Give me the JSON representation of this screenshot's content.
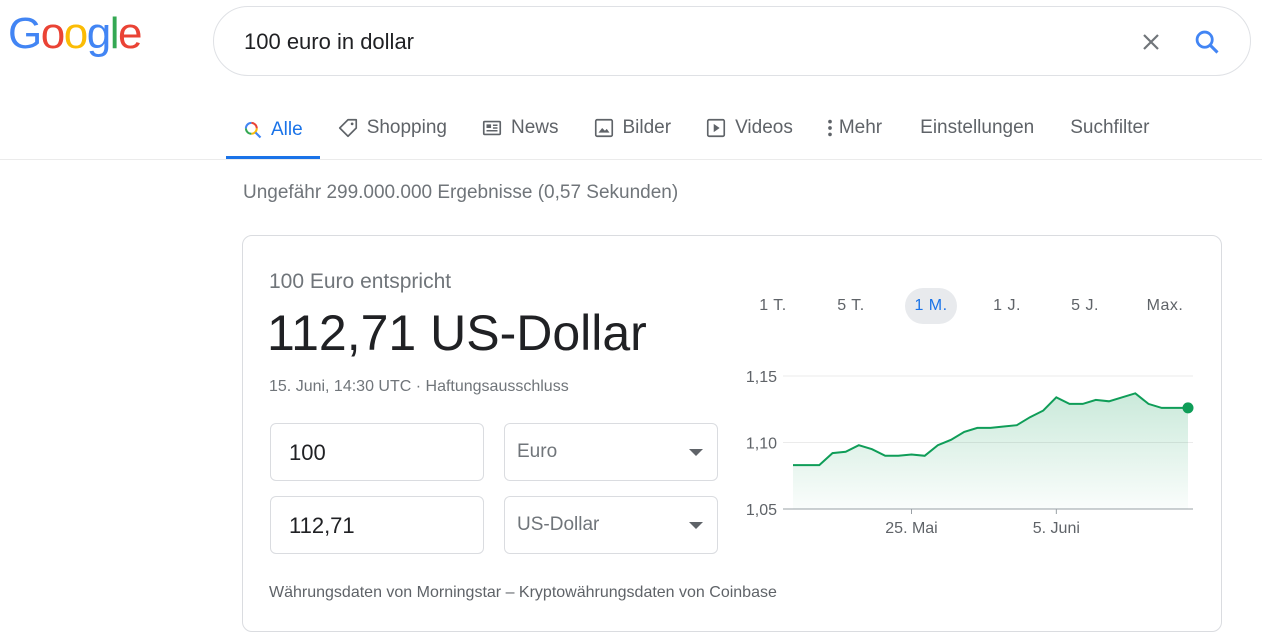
{
  "logo": {
    "letters": [
      "G",
      "o",
      "o",
      "g",
      "l",
      "e"
    ],
    "colors": [
      "#4285f4",
      "#ea4335",
      "#fbbc05",
      "#4285f4",
      "#34a853",
      "#ea4335"
    ]
  },
  "search": {
    "value": "100 euro in dollar",
    "clear_icon": "close-icon",
    "search_icon": "search-icon"
  },
  "tabs": [
    {
      "label": "Alle",
      "icon": "search-icon",
      "active": true
    },
    {
      "label": "Shopping",
      "icon": "tag-icon"
    },
    {
      "label": "News",
      "icon": "news-icon"
    },
    {
      "label": "Bilder",
      "icon": "image-icon"
    },
    {
      "label": "Videos",
      "icon": "video-icon"
    },
    {
      "label": "Mehr",
      "icon": "more-vert-icon"
    },
    {
      "label": "Einstellungen"
    },
    {
      "label": "Suchfilter"
    }
  ],
  "stats": "Ungefähr 299.000.000 Ergebnisse (0,57 Sekunden)",
  "converter": {
    "equals_label": "100 Euro entspricht",
    "result": "112,71 US-Dollar",
    "timestamp": "15. Juni, 14:30 UTC",
    "separator": " · ",
    "disclaimer": "Haftungsausschluss",
    "from_amount": "100",
    "from_currency": "Euro",
    "to_amount": "112,71",
    "to_currency": "US-Dollar",
    "ranges": [
      "1 T.",
      "5 T.",
      "1 M.",
      "1 J.",
      "5 J.",
      "Max."
    ],
    "active_range": "1 M.",
    "footer": {
      "source1": "Währungsdaten von Morningstar",
      "dash": " – ",
      "source2": "Kryptowährungsdaten von Coinbase"
    }
  },
  "colors": {
    "accent": "#1a73e8",
    "line": "#0f9d58"
  },
  "chart_data": {
    "type": "area",
    "x": [
      "",
      "",
      "",
      "",
      "",
      "",
      "",
      "",
      "",
      "",
      "",
      "",
      "",
      "",
      "",
      "",
      "",
      "",
      "",
      "",
      "",
      "",
      "",
      "",
      "",
      "",
      "",
      "",
      "",
      "",
      "",
      ""
    ],
    "values": [
      1.083,
      1.083,
      1.083,
      1.092,
      1.093,
      1.098,
      1.095,
      1.09,
      1.09,
      1.091,
      1.09,
      1.098,
      1.102,
      1.108,
      1.111,
      1.111,
      1.112,
      1.113,
      1.119,
      1.124,
      1.134,
      1.129,
      1.129,
      1.132,
      1.131,
      1.134,
      1.137,
      1.129,
      1.126,
      1.126,
      1.126
    ],
    "yticks": [
      "1,15",
      "1,10",
      "1,05"
    ],
    "ytick_values": [
      1.15,
      1.1,
      1.05
    ],
    "xticks": [
      "25. Mai",
      "5. Juni"
    ],
    "xtick_index": [
      9,
      20
    ],
    "ylim": [
      1.05,
      1.15
    ]
  }
}
